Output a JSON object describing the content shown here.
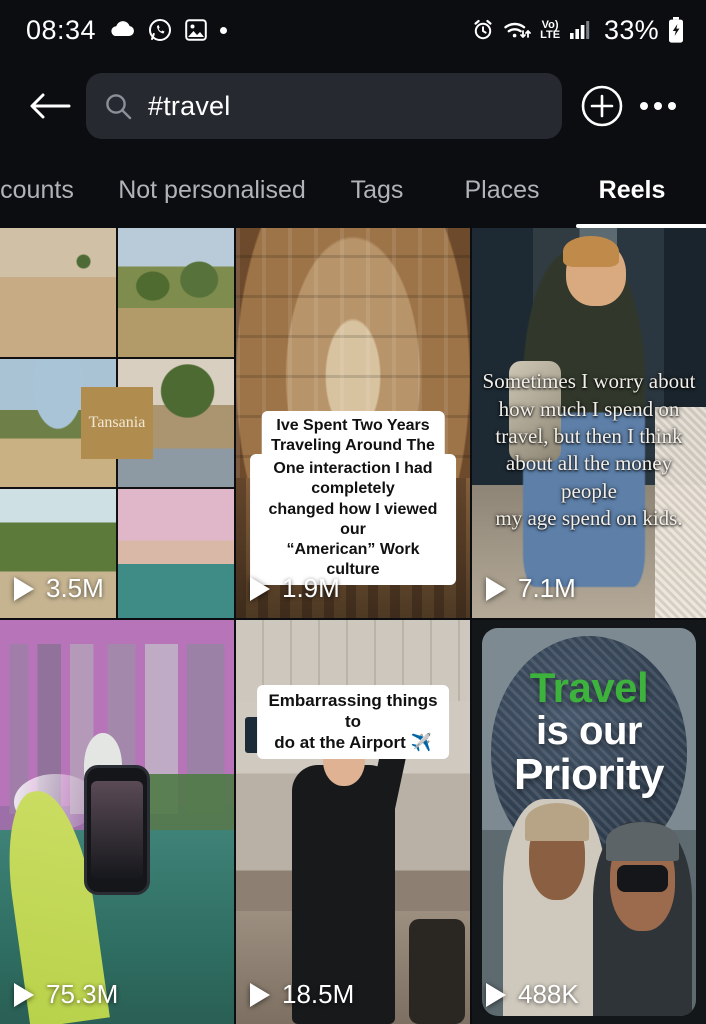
{
  "statusbar": {
    "time": "08:34",
    "battery_text": "33%",
    "volte_top": "Vo)",
    "volte_bottom": "LTE",
    "icons": [
      "cloud-icon",
      "whatsapp-icon",
      "photo-icon",
      "dot-icon",
      "alarm-icon",
      "wifi-icon",
      "volte-icon",
      "signal-icon",
      "battery-charging-icon"
    ]
  },
  "header": {
    "back_label": "←",
    "search_value": "#travel",
    "search_placeholder": "Search",
    "add_label": "+",
    "more_label": "More options"
  },
  "tabs": [
    {
      "label": "counts",
      "active": false
    },
    {
      "label": "Not personalised",
      "active": false
    },
    {
      "label": "Tags",
      "active": false
    },
    {
      "label": "Places",
      "active": false
    },
    {
      "label": "Reels",
      "active": true
    }
  ],
  "reels": [
    {
      "id": "reel-tansania",
      "views": "3.5M",
      "overlay_label": "Tansania",
      "caption": ""
    },
    {
      "id": "reel-two-years-traveling",
      "views": "1.9M",
      "caption_line1": "Ive Spent Two Years\nTraveling Around The World",
      "caption_line2": "One interaction I had completely\nchanged how I viewed our\n“American” Work culture"
    },
    {
      "id": "reel-money-people-my-age",
      "views": "7.1M",
      "caption": "Sometimes I worry about\nhow much I spend on\ntravel, but then I think\nabout all the money people\nmy age spend on kids."
    },
    {
      "id": "reel-singapore-merlion",
      "views": "75.3M",
      "caption": ""
    },
    {
      "id": "reel-embarrassing-airport",
      "views": "18.5M",
      "caption": "Embarrassing things to\ndo at the Airport ✈️"
    },
    {
      "id": "reel-travel-is-our-priority",
      "views": "488K",
      "title_line1": "Travel",
      "title_line2": "is our",
      "title_line3": "Priority"
    }
  ],
  "colors": {
    "background": "#0b0d10",
    "search_field": "#262930",
    "tab_inactive": "#b0b3b8",
    "tab_active": "#ffffff",
    "accent_green": "#3db23d",
    "tansania_box": "#b08d4f"
  }
}
